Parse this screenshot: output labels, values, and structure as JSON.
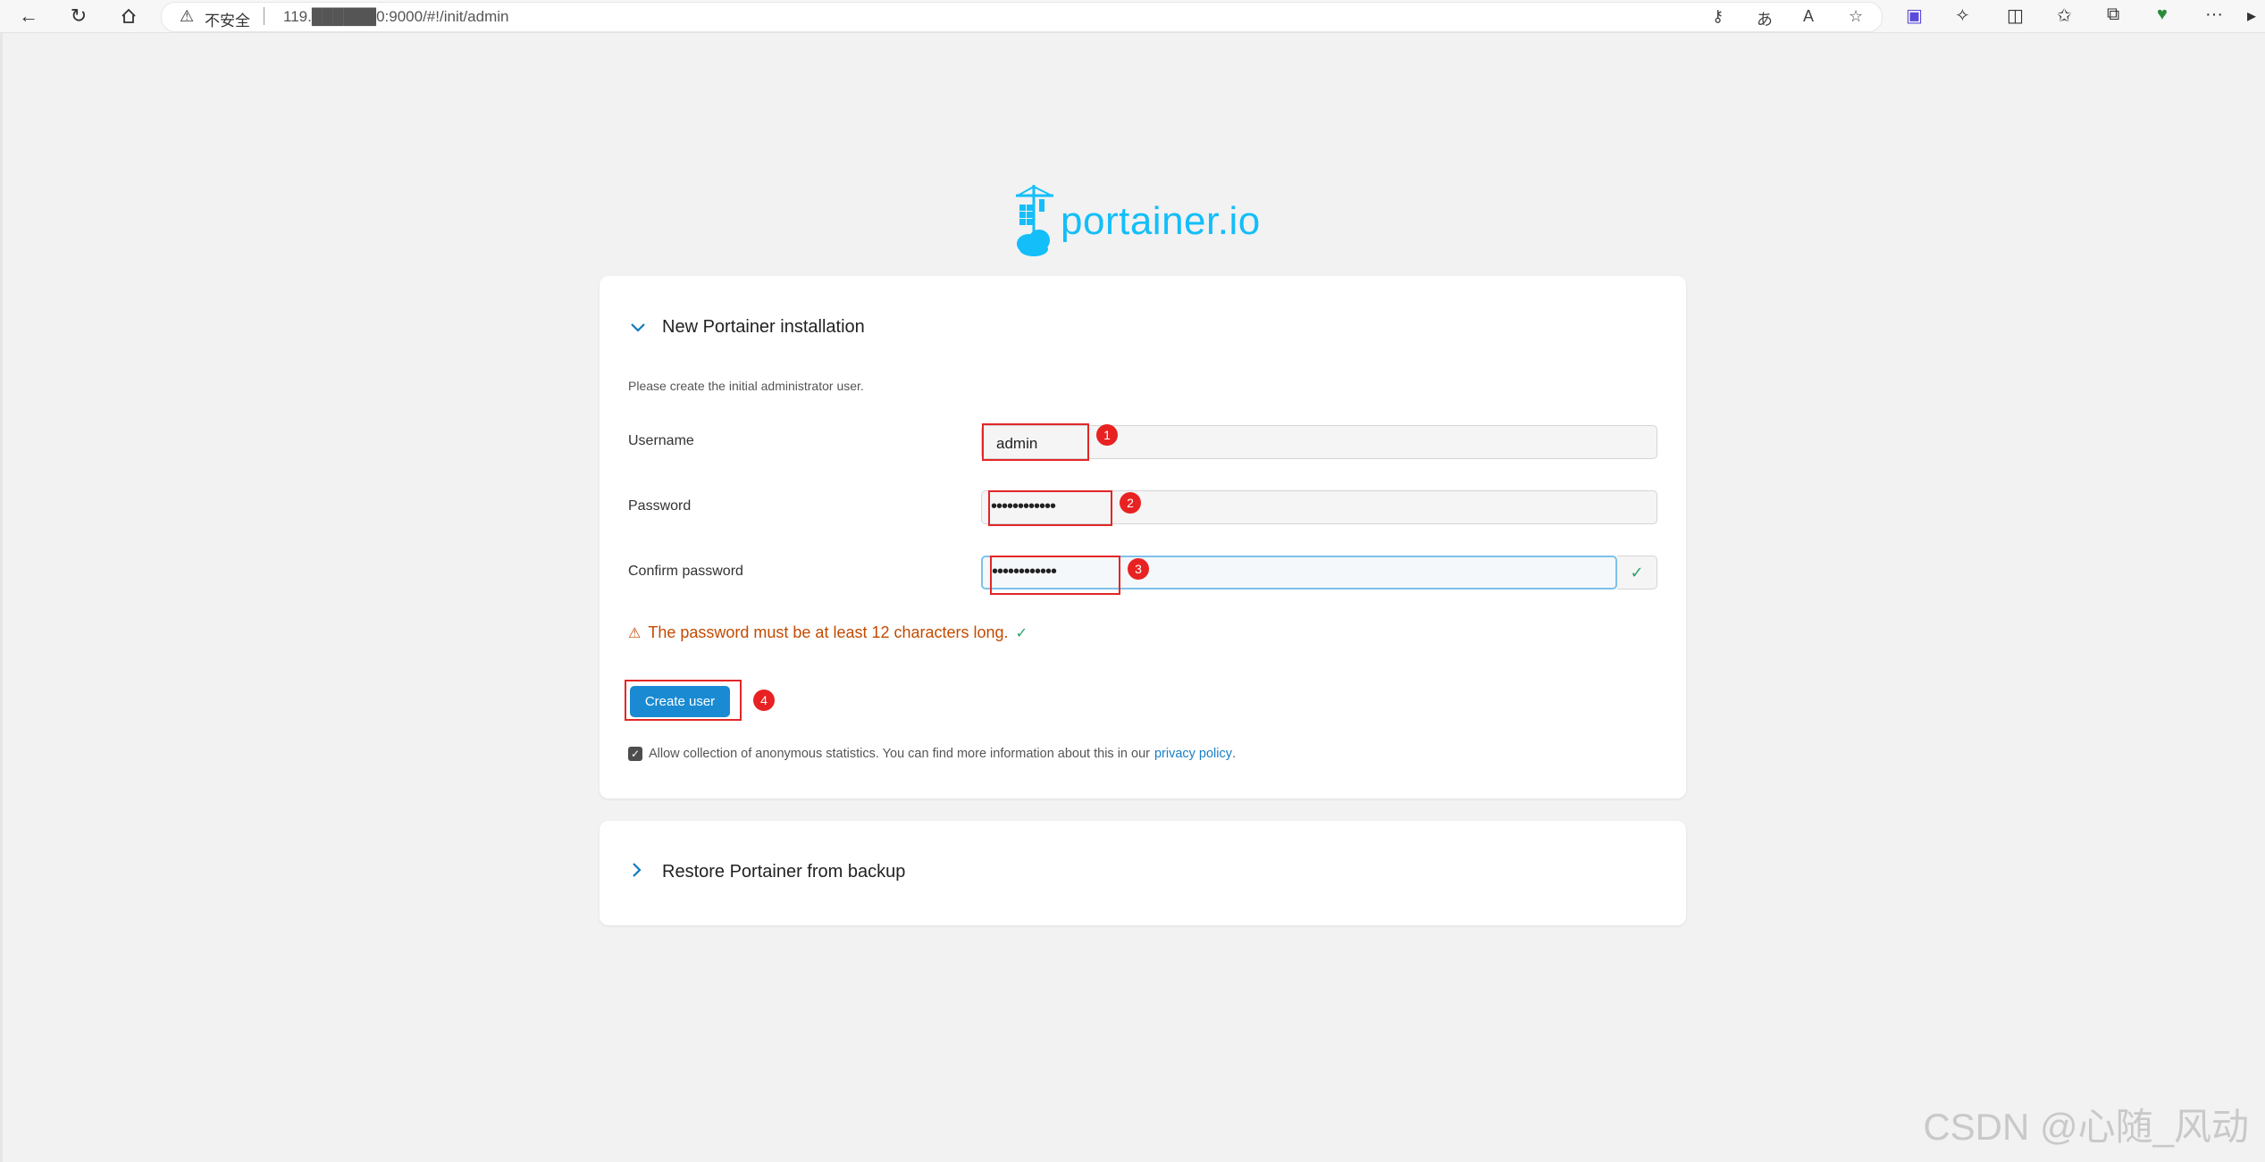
{
  "browser": {
    "insecure_label": "不安全",
    "url": "119.██████0:9000/#!/init/admin",
    "toolbar_icons": [
      "back-icon",
      "refresh-icon",
      "home-icon"
    ],
    "right_icons": [
      "key-icon",
      "translate-icon",
      "read-aloud-icon",
      "favorite-icon",
      "extension-colored-icon",
      "puzzle-icon",
      "split-screen-icon",
      "favorites-icon",
      "collections-icon",
      "performance-icon",
      "more-icon",
      "sidebar-icon"
    ],
    "more_label": "···"
  },
  "logo": {
    "text": "portainer.io",
    "color": "#13bef9"
  },
  "install_panel": {
    "title": "New Portainer installation",
    "hint": "Please create the initial administrator user.",
    "username_label": "Username",
    "username_value": "admin",
    "password_label": "Password",
    "password_value": "••••••••••••",
    "confirm_label": "Confirm password",
    "confirm_value": "••••••••••••",
    "warning": "The password must be at least 12 characters long.",
    "create_button": "Create user",
    "consent_text": "Allow collection of anonymous statistics. You can find more information about this in our",
    "privacy_link": "privacy policy",
    "consent_end": "."
  },
  "restore_panel": {
    "title": "Restore Portainer from backup"
  },
  "annotations": [
    "1",
    "2",
    "3",
    "4"
  ],
  "watermark": "CSDN @心随_风动",
  "colors": {
    "accent": "#1a8bd3",
    "warning": "#c24b00",
    "annotation_red": "#e32626"
  }
}
